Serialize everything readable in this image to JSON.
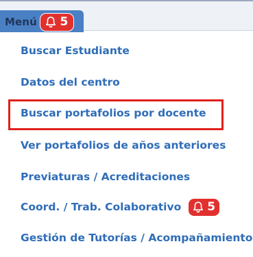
{
  "menu": {
    "label": "Menú",
    "badge_count": "5",
    "badge_icon": "bell-icon"
  },
  "items": [
    {
      "label": "Buscar Estudiante"
    },
    {
      "label": "Datos del centro"
    },
    {
      "label": "Buscar portafolios por docente",
      "highlighted": true
    },
    {
      "label": "Ver portafolios de años anteriores"
    },
    {
      "label": "Previaturas / Acreditaciones"
    },
    {
      "label": "Coord. / Trab. Colaborativo",
      "badge_count": "5",
      "badge_icon": "bell-icon"
    },
    {
      "label": "Gestión de Tutorías / Acompañamiento"
    }
  ],
  "colors": {
    "accent": "#4a80c4",
    "link": "#2f6db8",
    "badge": "#e1312e",
    "highlight": "#e0201c"
  }
}
